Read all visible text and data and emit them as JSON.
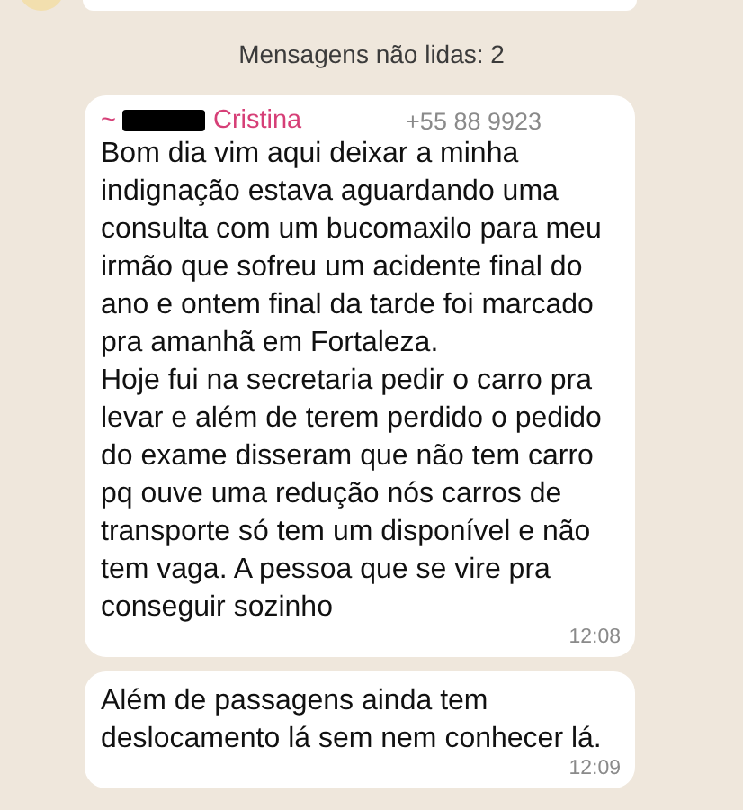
{
  "unread_banner": "Mensagens não lidas: 2",
  "messages": [
    {
      "sender": {
        "prefix": "~",
        "redacted": true,
        "name": "Cristina",
        "phone": "+55 88 9923"
      },
      "paragraphs": [
        "Bom dia vim aqui deixar a minha indignação estava aguardando uma consulta com um bucomaxilo para meu irmão que sofreu um acidente final do ano e ontem final da tarde foi marcado pra amanhã em Fortaleza.",
        "Hoje fui na secretaria pedir o carro pra levar e além de terem perdido o pedido do exame disseram que não tem carro pq ouve uma redução nós carros de transporte só tem um disponível e não tem vaga. A pessoa que se vire pra conseguir sozinho"
      ],
      "time": "12:08"
    },
    {
      "paragraphs": [
        "Além de passagens ainda tem deslocamento lá sem nem conhecer lá."
      ],
      "time": "12:09"
    }
  ]
}
